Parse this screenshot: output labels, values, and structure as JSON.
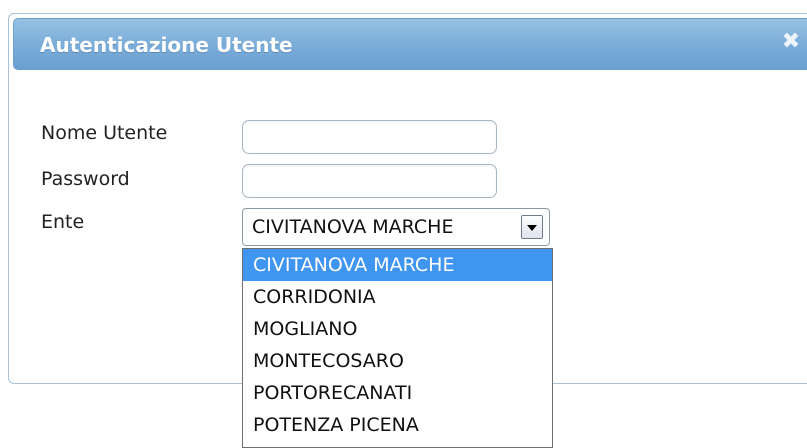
{
  "dialog": {
    "title": "Autenticazione Utente",
    "close_icon": "close-icon",
    "close_glyph": "✖"
  },
  "form": {
    "username_label": "Nome Utente",
    "username_value": "",
    "password_label": "Password",
    "password_value": "",
    "ente_label": "Ente",
    "ente_selected": "CIVITANOVA MARCHE"
  },
  "dropdown": {
    "options": [
      "CIVITANOVA MARCHE",
      "CORRIDONIA",
      "MOGLIANO",
      "MONTECOSARO",
      "PORTORECANATI",
      "POTENZA PICENA"
    ],
    "highlighted_index": 0
  },
  "colors": {
    "title_bar": "#7eafda",
    "highlight": "#3f95f0"
  }
}
